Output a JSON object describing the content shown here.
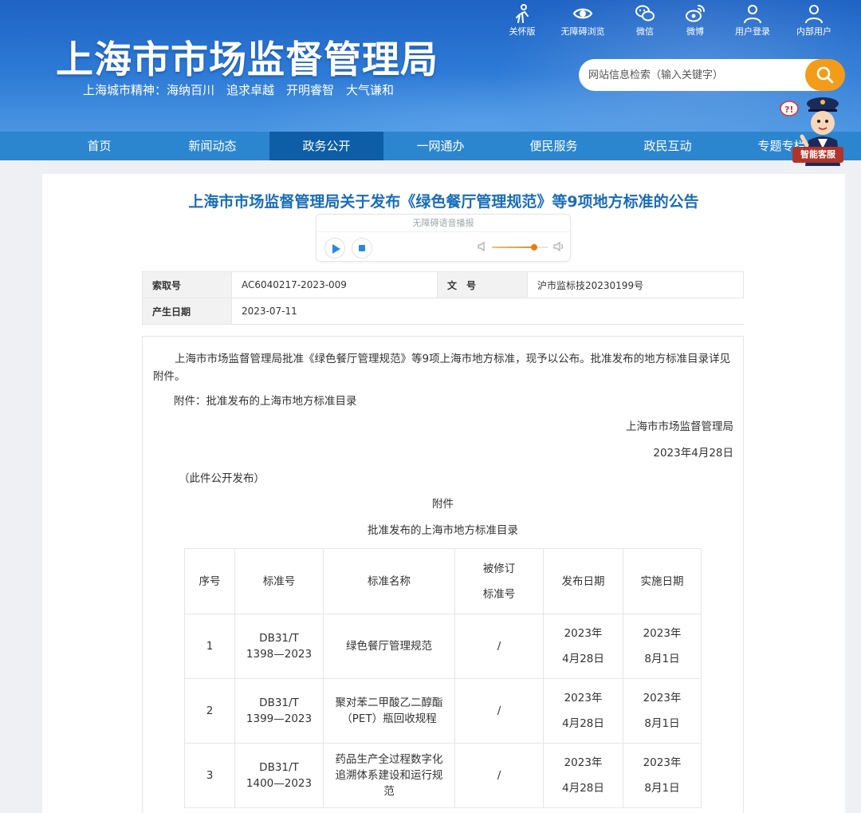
{
  "header": {
    "site_title": "上海市市场监督管理局",
    "slogan": "上海城市精神：海纳百川　追求卓越　开明睿智　大气谦和",
    "top_links": [
      {
        "label": "关怀版",
        "icon": "elder-care-icon"
      },
      {
        "label": "无障碍浏览",
        "icon": "eye-icon"
      },
      {
        "label": "微信",
        "icon": "wechat-icon"
      },
      {
        "label": "微博",
        "icon": "weibo-icon"
      },
      {
        "label": "用户登录",
        "icon": "user-icon"
      },
      {
        "label": "内部用户",
        "icon": "user-icon"
      }
    ],
    "search_placeholder": "网站信息检索（输入关键字）",
    "mascot_label": "智能客服"
  },
  "nav": {
    "items": [
      "首页",
      "新闻动态",
      "政务公开",
      "一网通办",
      "便民服务",
      "政民互动",
      "专题专栏"
    ],
    "active": "政务公开"
  },
  "article": {
    "title": "上海市市场监督管理局关于发布《绿色餐厅管理规范》等9项地方标准的公告",
    "audio_title": "无障碍语音播报",
    "volume_level": 0.75,
    "meta": {
      "index_label": "索取号",
      "index_value": "AC6040217-2023-009",
      "doc_no_label": "文　号",
      "doc_no_value": "沪市监标技20230199号",
      "date_label": "产生日期",
      "date_value": "2023-07-11"
    },
    "paragraph1": "上海市市场监督管理局批准《绿色餐厅管理规范》等9项上海市地方标准，现予以公布。批准发布的地方标准目录详见附件。",
    "attachment_line": "附件：批准发布的上海市地方标准目录",
    "signature": "上海市市场监督管理局",
    "sign_date": "2023年4月28日",
    "publish_note": "（此件公开发布）",
    "appendix_title": "附件",
    "appendix_subtitle": "批准发布的上海市地方标准目录",
    "table": {
      "headers": [
        "序号",
        "标准号",
        "标准名称",
        "被修订标准号",
        "发布日期",
        "实施日期"
      ],
      "rows": [
        [
          "1",
          "DB31/T 1398—2023",
          "绿色餐厅管理规范",
          "/",
          "2023年4月28日",
          "2023年8月1日"
        ],
        [
          "2",
          "DB31/T 1399—2023",
          "聚对苯二甲酸乙二醇酯（PET）瓶回收规程",
          "/",
          "2023年4月28日",
          "2023年8月1日"
        ],
        [
          "3",
          "DB31/T 1400—2023",
          "药品生产全过程数字化追溯体系建设和运行规范",
          "/",
          "2023年4月28日",
          "2023年8月1日"
        ]
      ]
    }
  }
}
